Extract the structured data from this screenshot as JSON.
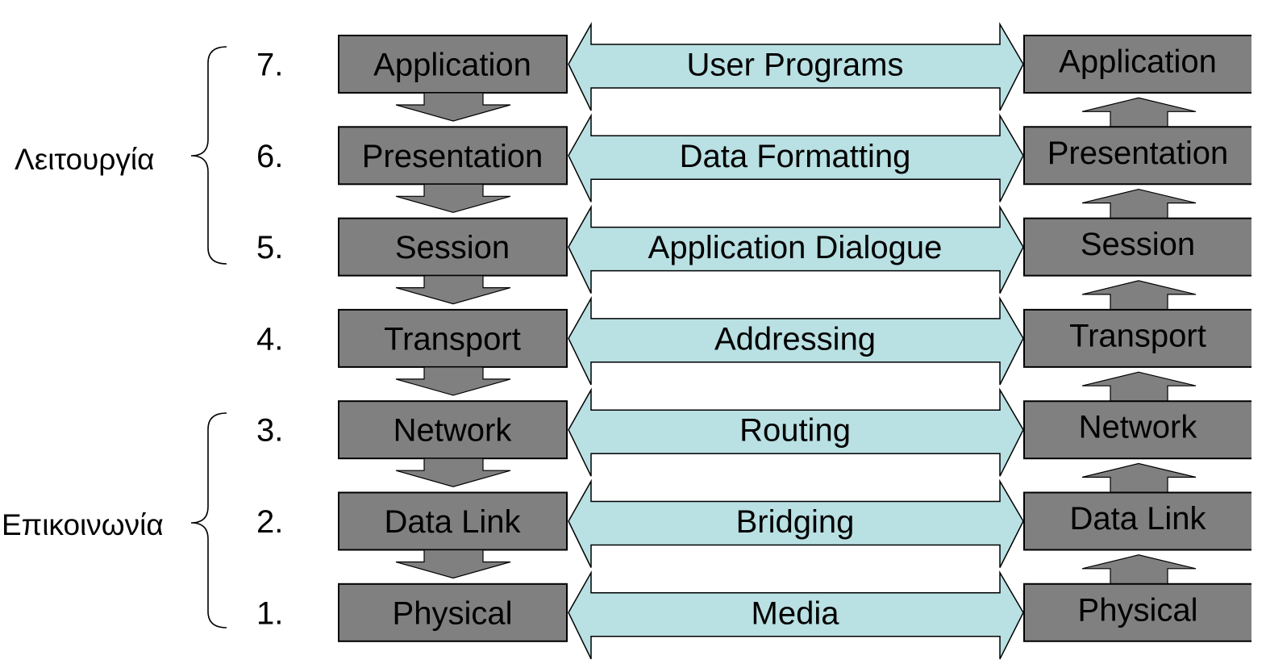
{
  "groups": [
    {
      "label": "Λειτουργία",
      "layers": [
        7,
        6,
        5
      ]
    },
    {
      "label": "Επικοινωνία",
      "layers": [
        3,
        2,
        1
      ]
    }
  ],
  "layers": [
    {
      "number": "7.",
      "left": "Application",
      "middle": "User Programs",
      "right": "Application"
    },
    {
      "number": "6.",
      "left": "Presentation",
      "middle": "Data Formatting",
      "right": "Presentation"
    },
    {
      "number": "5.",
      "left": "Session",
      "middle": "Application Dialogue",
      "right": "Session"
    },
    {
      "number": "4.",
      "left": "Transport",
      "middle": "Addressing",
      "right": "Transport"
    },
    {
      "number": "3.",
      "left": "Network",
      "middle": "Routing",
      "right": "Network"
    },
    {
      "number": "2.",
      "left": "Data Link",
      "middle": "Bridging",
      "right": "Data Link"
    },
    {
      "number": "1.",
      "left": "Physical",
      "middle": "Media",
      "right": "Physical"
    }
  ],
  "colors": {
    "layer_box": "#808080",
    "peer_arrow": "#b9e0e3"
  }
}
